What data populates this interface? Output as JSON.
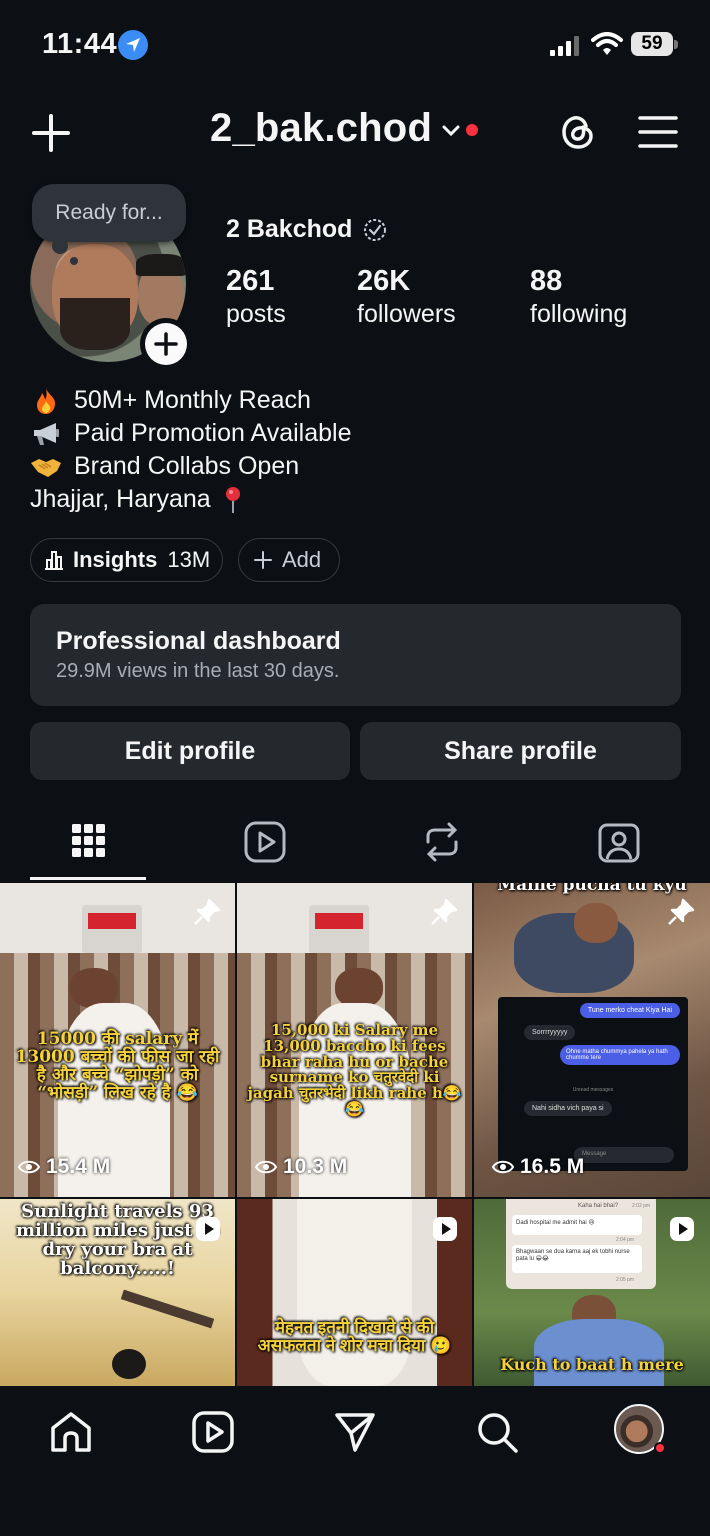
{
  "status_bar": {
    "time": "11:44",
    "battery": "59"
  },
  "header": {
    "username": "2_bak.chod"
  },
  "profile": {
    "note": "Ready for...",
    "display_name": "2 Bakchod",
    "stats": [
      {
        "value": "261",
        "label": "posts"
      },
      {
        "value": "26K",
        "label": "followers"
      },
      {
        "value": "88",
        "label": "following"
      }
    ],
    "bio": [
      {
        "emoji": "fire",
        "text": "50M+ Monthly Reach"
      },
      {
        "emoji": "megaphone",
        "text": "Paid Promotion Available"
      },
      {
        "emoji": "handshake",
        "text": "Brand Collabs Open"
      },
      {
        "emoji": "",
        "text": "Jhajjar, Haryana"
      }
    ]
  },
  "pills": {
    "insights_label": "Insights",
    "insights_value": "13M",
    "add_label": "Add"
  },
  "dashboard": {
    "title": "Professional dashboard",
    "subtitle": "29.9M views in the last 30 days."
  },
  "buttons": {
    "edit": "Edit profile",
    "share": "Share profile"
  },
  "grid": [
    {
      "overlay": "15000 की salary में 13000 बच्चों की फीस जा रही है और बच्चे “झोपड़ी” को “भोसड़ी” लिख रहे है 😂",
      "views": "15.4 M",
      "pinned": true
    },
    {
      "overlay": "15,000 ki Salary me 13,000 baccho ki fees bhar raha hu or bache surname ko चतुरवेदी ki jagah चुतरभेदी likh rahe h😂😂",
      "views": "10.3 M",
      "pinned": true
    },
    {
      "overlay": "Maine pucha tu kyu",
      "views": "16.5 M",
      "pinned": true,
      "chat": [
        "Tune merko cheat Kiya Hai",
        "Sorrrryyyyy",
        "Ohne matha chummya pahela ya hath chumme tere",
        "Unread messages",
        "Nahi sidha vich paya si",
        "Message"
      ]
    },
    {
      "overlay": "Sunlight travels 93 million miles just to dry your bra at balcony.....!",
      "reel": true
    },
    {
      "overlay": "मेहनत इतनी दिखावे से की असफलता ने शोर मचा दिया 🥲",
      "reel": true
    },
    {
      "overlay": "Kuch to baat h mere",
      "reel": true,
      "chat": [
        "Kaha hai bhai?",
        "2:02 pm",
        "Dadi hospital me admit hai 😢",
        "2:04 pm",
        "Bhagwaan se dua karna aaj ek tobhi nurse pata lu 😁😂",
        "2:05 pm"
      ]
    }
  ]
}
